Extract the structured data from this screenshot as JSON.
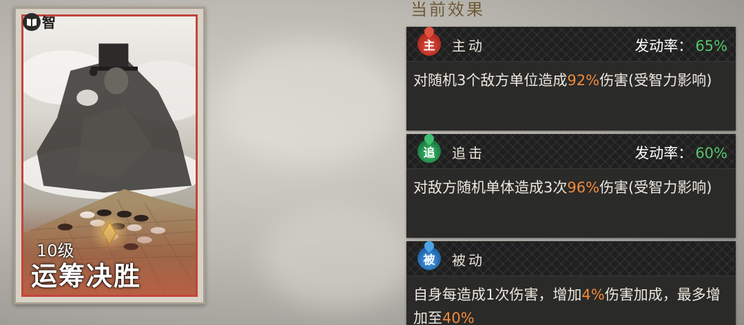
{
  "card": {
    "attribute": "智",
    "attribute_icon": "book-icon",
    "level": "10级",
    "name": "运筹决胜",
    "frame_color": "#c2453b"
  },
  "panel_title": "当前效果",
  "effects": [
    {
      "badge": "主",
      "badge_color": "#c9392b",
      "type": "主动",
      "rate_label": "发动率：",
      "rate_value": "65%",
      "desc_pre": "对随机3个敌方单位造成",
      "desc_hl": "92%",
      "desc_post": "伤害(受智力影响)"
    },
    {
      "badge": "追",
      "badge_color": "#2a9a55",
      "type": "追击",
      "rate_label": "发动率：",
      "rate_value": "60%",
      "desc_pre": "对敌方随机单体造成3次",
      "desc_hl": "96%",
      "desc_post": "伤害(受智力影响)"
    },
    {
      "badge": "被",
      "badge_color": "#2f7fc6",
      "type": "被动",
      "desc_pre": "自身每造成1次伤害，增加",
      "desc_hl": "4%",
      "desc_mid": "伤害加成，最多增加至",
      "desc_hl2": "40%"
    }
  ],
  "colors": {
    "highlight": "#f08a3a",
    "rate_green": "#55c46b",
    "panel_bg": "#2a2a29"
  }
}
